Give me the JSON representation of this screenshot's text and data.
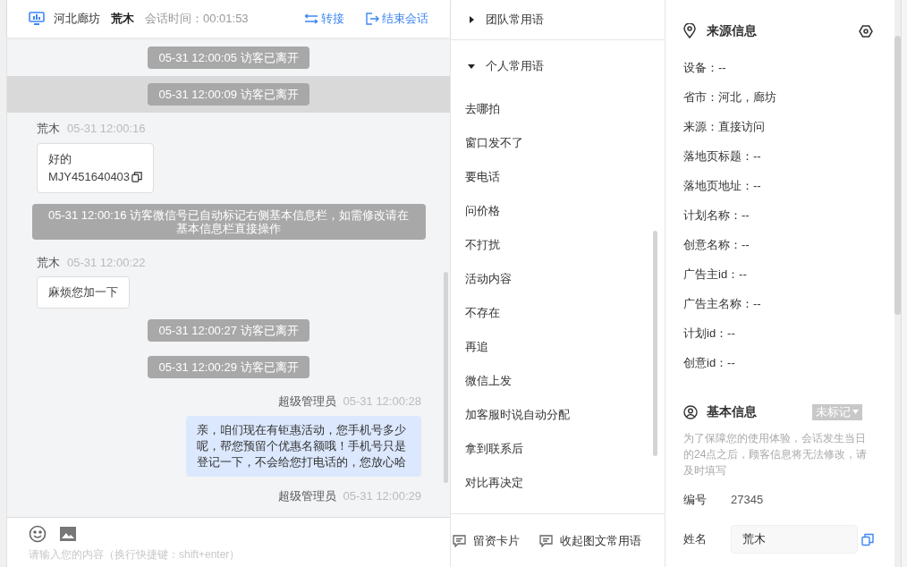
{
  "header": {
    "location": "河北廊坊",
    "visitor": "荒木",
    "session_label": "会话时间：",
    "session_time": "00:01:53",
    "actions": [
      "转接",
      "结束会话"
    ]
  },
  "messages": [
    {
      "kind": "system",
      "text": "05-31 12:00:05 访客已离开",
      "highlighted": false
    },
    {
      "kind": "system",
      "text": "05-31 12:00:09 访客已离开",
      "highlighted": true
    },
    {
      "kind": "visitor",
      "sender": "荒木",
      "time": "05-31 12:00:16",
      "lines": [
        "好的",
        "MJY451640403"
      ],
      "copyable": true
    },
    {
      "kind": "system",
      "text": "05-31 12:00:16 访客微信号已自动标记右侧基本信息栏，如需修改请在基本信息栏直接操作",
      "highlighted": false
    },
    {
      "kind": "visitor",
      "sender": "荒木",
      "time": "05-31 12:00:22",
      "lines": [
        "麻烦您加一下"
      ],
      "copyable": false
    },
    {
      "kind": "system",
      "text": "05-31 12:00:27 访客已离开",
      "highlighted": false
    },
    {
      "kind": "system",
      "text": "05-31 12:00:29 访客已离开",
      "highlighted": false
    },
    {
      "kind": "agent",
      "sender": "超级管理员",
      "time": "05-31 12:00:28",
      "lines": [
        "亲，咱们现在有钜惠活动，您手机号多少呢，帮您预留个优惠名额哦！手机号只是登记一下，不会给您打电话的，您放心哈"
      ]
    },
    {
      "kind": "agent",
      "sender": "超级管理员",
      "time": "05-31 12:00:29"
    }
  ],
  "composer": {
    "placeholder": "请输入您的内容（换行快捷键：shift+enter）"
  },
  "phrases": {
    "groups": [
      {
        "title": "团队常用语",
        "expanded": false
      },
      {
        "title": "个人常用语",
        "expanded": true
      }
    ],
    "items": [
      "去哪拍",
      "窗口发不了",
      "要电话",
      "问价格",
      "不打扰",
      "活动内容",
      "不存在",
      "再追",
      "微信上发",
      "加客服时说自动分配",
      "拿到联系后",
      "对比再决定"
    ],
    "footer": [
      "留资卡片",
      "收起图文常用语"
    ]
  },
  "source_info": {
    "title": "来源信息",
    "fields": [
      "设备：--",
      "省市：河北，廊坊",
      "来源：直接访问",
      "落地页标题：--",
      "落地页地址：--",
      "计划名称：--",
      "创意名称：--",
      "广告主id：--",
      "广告主名称：--",
      "计划id：--",
      "创意id：--"
    ]
  },
  "basic_info": {
    "title": "基本信息",
    "tag": "未标记",
    "note": "为了保障您的使用体验，会话发生当日的24点之后，顾客信息将无法修改，请及时填写",
    "id_label": "编号",
    "id_value": "27345",
    "name_label": "姓名",
    "name_value": "荒木"
  }
}
